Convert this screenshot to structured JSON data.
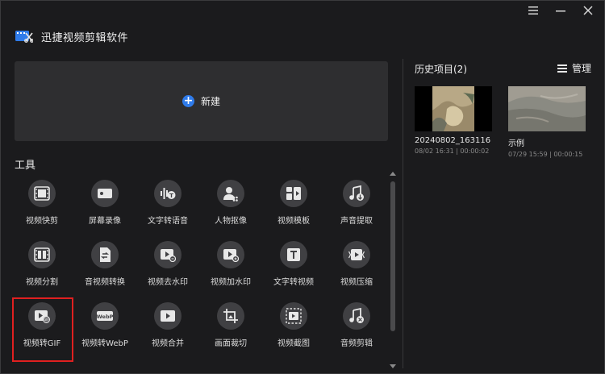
{
  "app": {
    "title": "迅捷视频剪辑软件"
  },
  "window_controls": {
    "menu_icon": "hamburger-icon",
    "minimize_icon": "minimize-icon",
    "close_icon": "close-icon"
  },
  "new_project": {
    "label": "新建",
    "icon": "plus-circle-icon",
    "accent": "#2f7bea"
  },
  "tools": {
    "heading": "工具",
    "items": [
      {
        "label": "视频快剪",
        "icon": "film-icon"
      },
      {
        "label": "屏幕录像",
        "icon": "screen-record-icon"
      },
      {
        "label": "文字转语音",
        "icon": "text-to-speech-icon"
      },
      {
        "label": "人物抠像",
        "icon": "person-cutout-icon"
      },
      {
        "label": "视频模板",
        "icon": "template-icon"
      },
      {
        "label": "声音提取",
        "icon": "audio-extract-icon"
      },
      {
        "label": "视频分割",
        "icon": "split-icon"
      },
      {
        "label": "音视频转换",
        "icon": "convert-icon"
      },
      {
        "label": "视频去水印",
        "icon": "remove-watermark-icon"
      },
      {
        "label": "视频加水印",
        "icon": "add-watermark-icon"
      },
      {
        "label": "文字转视频",
        "icon": "text-to-video-icon"
      },
      {
        "label": "视频压缩",
        "icon": "compress-icon"
      },
      {
        "label": "视频转GIF",
        "icon": "gif-icon",
        "selected": true
      },
      {
        "label": "视频转WebP",
        "icon": "webp-icon"
      },
      {
        "label": "视频合并",
        "icon": "merge-icon"
      },
      {
        "label": "画面裁切",
        "icon": "crop-icon"
      },
      {
        "label": "视频截图",
        "icon": "screenshot-icon"
      },
      {
        "label": "音频剪辑",
        "icon": "audio-edit-icon"
      }
    ],
    "highlight_color": "#e02020"
  },
  "history": {
    "title": "历史项目(2)",
    "manage_label": "管理",
    "items": [
      {
        "name": "20240802_163116",
        "meta": "08/02 16:31 | 00:00:02"
      },
      {
        "name": "示例",
        "meta": "07/29 15:59 | 00:00:15"
      }
    ]
  }
}
